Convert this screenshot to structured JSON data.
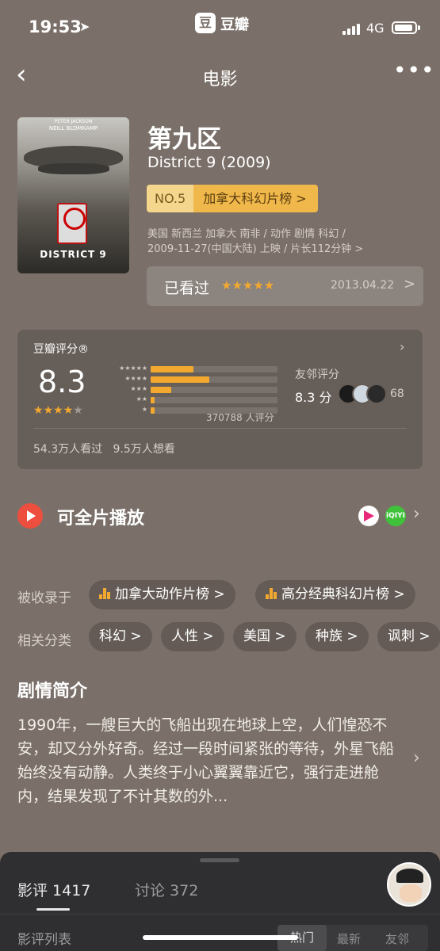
{
  "status_bar": {
    "time": "19:53",
    "app_name": "豆瓣",
    "app_badge": "豆",
    "network": "4G"
  },
  "nav": {
    "title": "电影",
    "back_icon": "chevron-left-icon",
    "more_icon": "more-icon"
  },
  "movie": {
    "title": "第九区",
    "subtitle": "District 9 (2009)",
    "rank_no": "NO.5",
    "rank_list": "加拿大科幻片榜 >",
    "meta_line1": "美国 新西兰 加拿大 南非 / 动作 剧情 科幻 /",
    "meta_line2": "2009-11-27(中国大陆) 上映 / 片长112分钟 >",
    "poster": {
      "top_text": "PETER JACKSON",
      "director_text": "NEILL BLOMKAMP",
      "title_text": "DISTRICT 9"
    }
  },
  "watched": {
    "label": "已看过",
    "stars": "★★★★★",
    "rating": 5,
    "date": "2013.04.22",
    "chevron": ">"
  },
  "rating": {
    "label": "豆瓣评分®",
    "score": "8.3",
    "stars": 4,
    "distribution": [
      {
        "stars": "★★★★★",
        "fraction": 0.34
      },
      {
        "stars": "★★★★",
        "fraction": 0.46
      },
      {
        "stars": "★★★",
        "fraction": 0.16
      },
      {
        "stars": "★★",
        "fraction": 0.03
      },
      {
        "stars": "★",
        "fraction": 0.03
      }
    ],
    "count": "370788 人评分",
    "friends_label": "友邻评分",
    "friends_score": "8.3 分",
    "friends_count": "68",
    "footer": "54.3万人看过   9.5万人想看"
  },
  "play": {
    "label": "可全片播放",
    "platform2": "iQIYI"
  },
  "collections": {
    "label": "被收录于",
    "items": [
      "加拿大动作片榜 >",
      "高分经典科幻片榜 >"
    ]
  },
  "tags": {
    "label": "相关分类",
    "items": [
      "科幻 >",
      "人性 >",
      "美国 >",
      "种族 >",
      "讽刺 >"
    ]
  },
  "synopsis": {
    "title": "剧情简介",
    "text": "1990年，一艘巨大的飞船出现在地球上空，人们惶恐不安，却又分外好奇。经过一段时间紧张的等待，外星飞船始终没有动静。人类终于小心翼翼靠近它，强行走进舱内，结果发现了不计其数的外..."
  },
  "sheet": {
    "tab_reviews": "影评 1417",
    "tab_discussions": "讨论 372",
    "list_label": "影评列表",
    "segments": [
      "热门",
      "最新",
      "友邻"
    ]
  },
  "colors": {
    "background": "#7a7069",
    "accent_star": "#f3a92f",
    "play_red": "#ed4e3e",
    "sheet": "#2f2f31"
  }
}
